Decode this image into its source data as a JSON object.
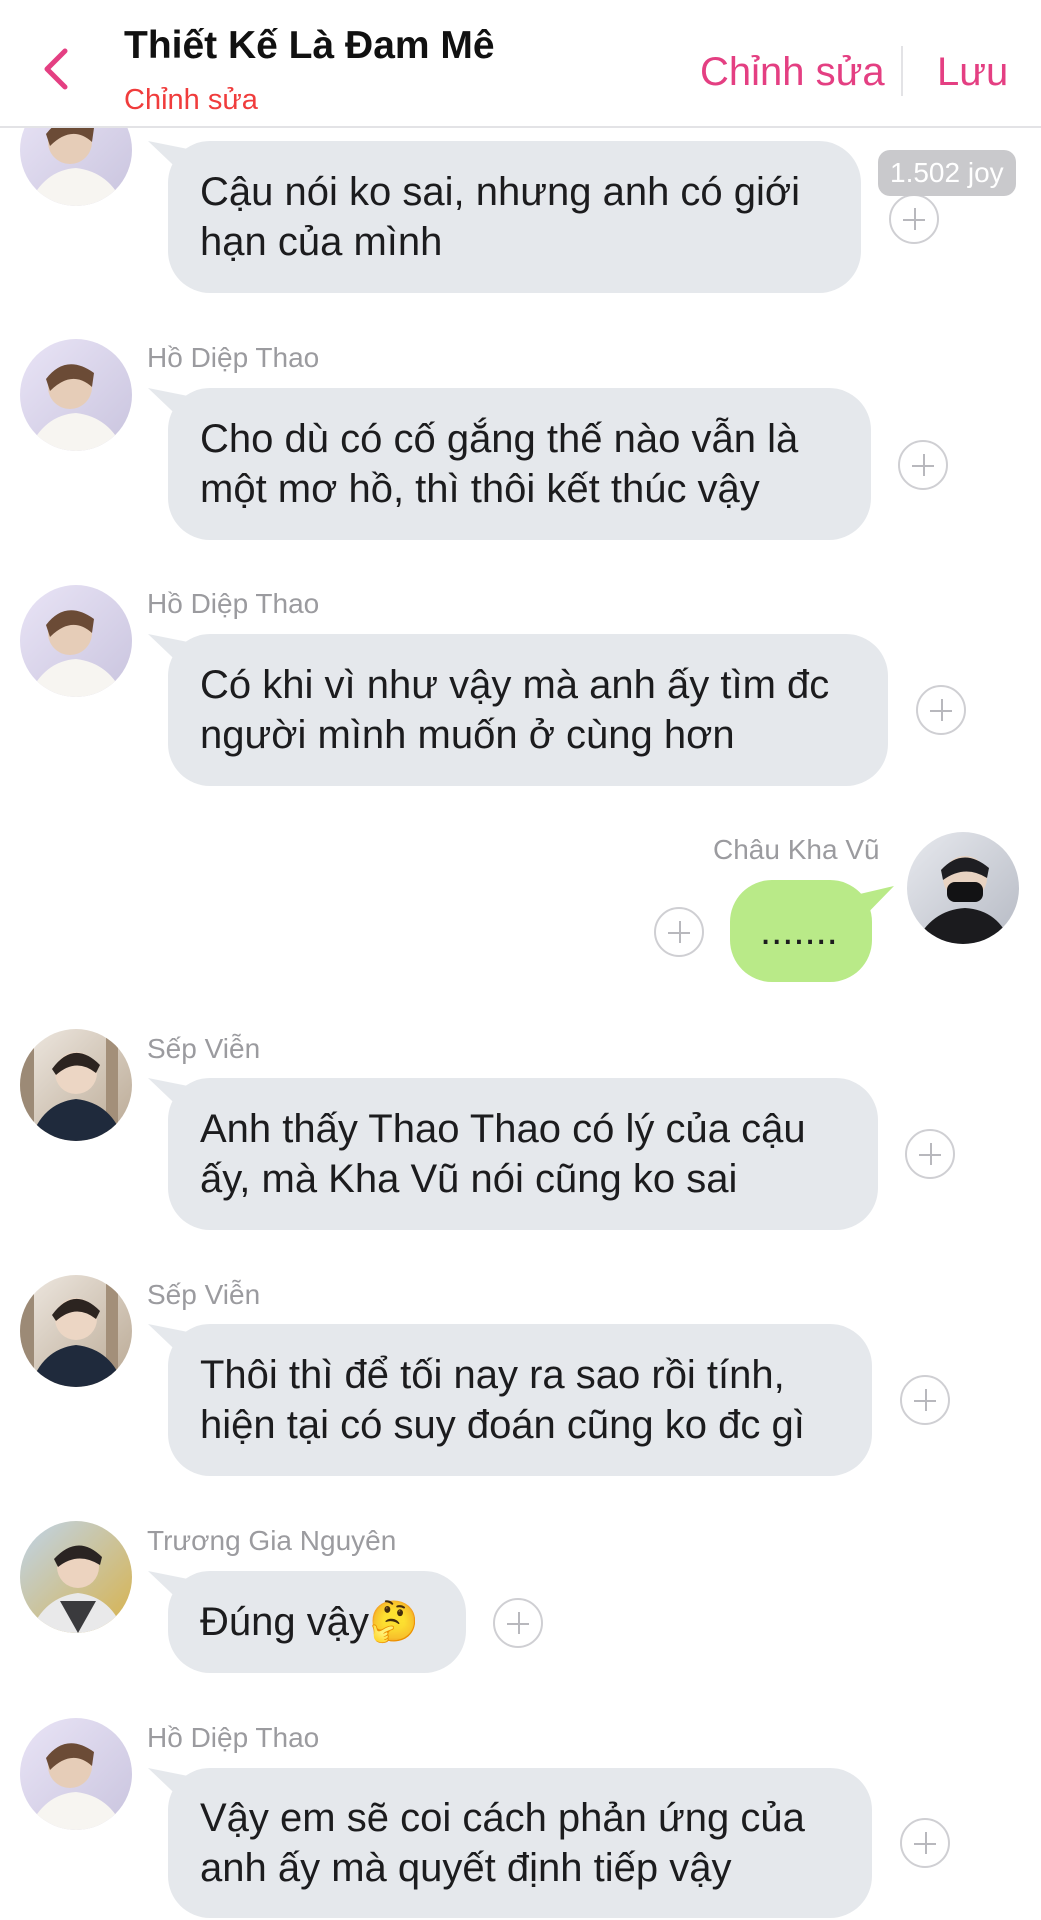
{
  "header": {
    "title": "Thiết Kế Là Đam Mê",
    "subtitle": "Chỉnh sửa",
    "edit_label": "Chỉnh sửa",
    "save_label": "Lưu"
  },
  "colors": {
    "accent": "#e43f82",
    "subtitle": "#f03c3c",
    "incoming_bubble": "#e5e8ec",
    "outgoing_bubble": "#b9ea88"
  },
  "badge": "1.502 joy",
  "messages": [
    {
      "sender": "",
      "text": "Cậu nói ko sai, nhưng anh có giới\nhạn của mình",
      "avatar": "ho-diep-thao"
    },
    {
      "sender": "Hồ Diệp Thao",
      "text": "Cho dù có cố gắng thế nào vẫn là\nmột mơ hồ, thì thôi kết thúc vậy",
      "avatar": "ho-diep-thao"
    },
    {
      "sender": "Hồ Diệp Thao",
      "text": "Có khi vì như vậy mà anh ấy tìm đc\nngười mình muốn ở cùng hơn",
      "avatar": "ho-diep-thao"
    },
    {
      "sender": "Châu Kha Vũ",
      "text": ".......",
      "avatar": "chau-kha-vu"
    },
    {
      "sender": "Sếp Viễn",
      "text": "Anh thấy Thao Thao có lý của cậu\nấy, mà Kha Vũ nói cũng ko sai",
      "avatar": "sep-vien"
    },
    {
      "sender": "Sếp Viễn",
      "text": "Thôi thì để tối nay ra sao rồi tính,\nhiện tại có suy đoán cũng ko đc gì",
      "avatar": "sep-vien"
    },
    {
      "sender": "Trương Gia Nguyên",
      "text": "Đúng vậy🤔",
      "avatar": "truong-gia-nguyen"
    },
    {
      "sender": "Hồ Diệp Thao",
      "text": "Vậy em sẽ coi cách phản ứng của\nanh ấy mà quyết định tiếp vậy",
      "avatar": "ho-diep-thao"
    }
  ]
}
